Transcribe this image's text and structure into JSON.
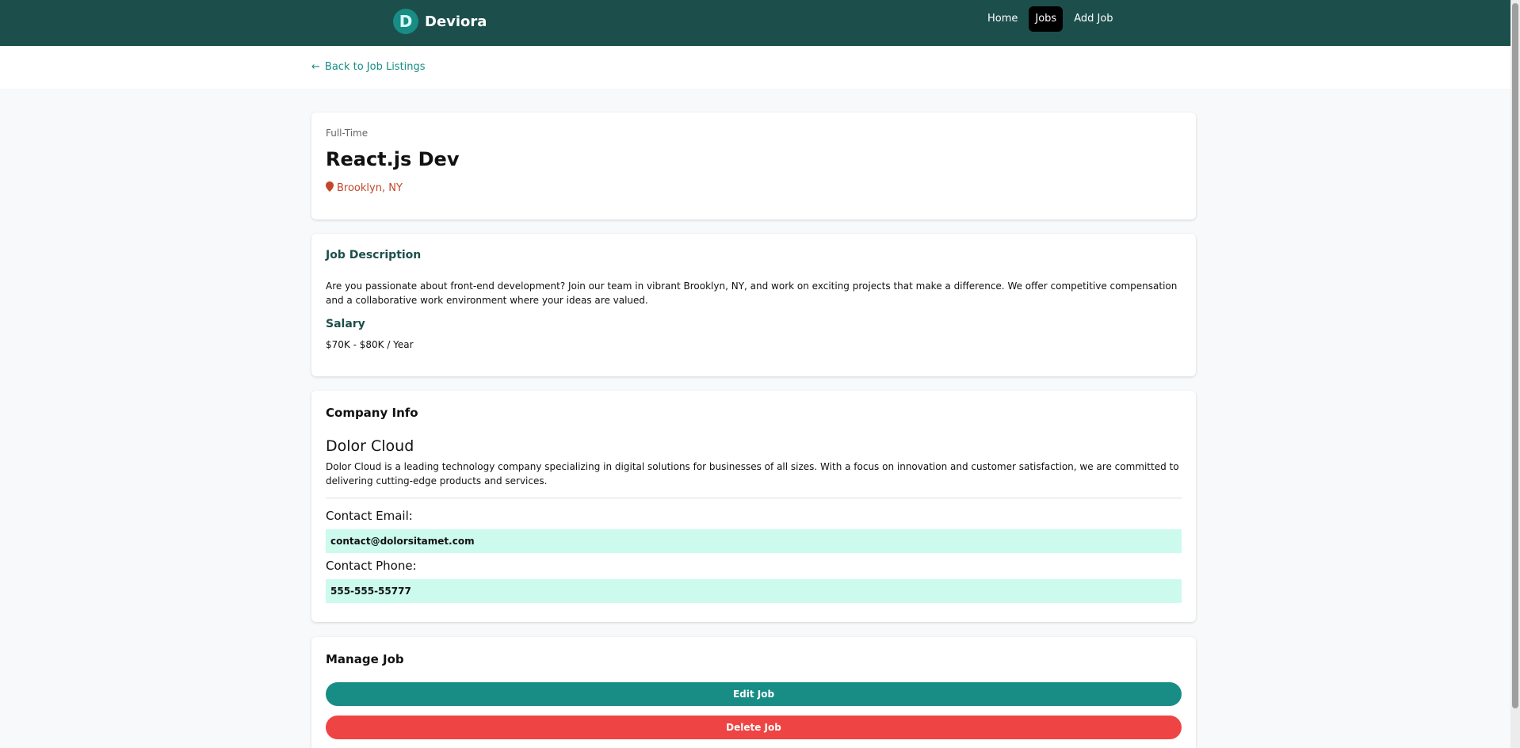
{
  "nav": {
    "logo_letter": "D",
    "brand_name": "Deviora",
    "links": [
      {
        "label": "Home"
      },
      {
        "label": "Jobs"
      },
      {
        "label": "Add Job"
      }
    ]
  },
  "back_link": {
    "label": "Back to Job Listings",
    "icon": "arrow-left-icon"
  },
  "job": {
    "type": "Full-Time",
    "title": "React.js Dev",
    "location": "Brooklyn, NY",
    "location_icon": "map-pin-icon",
    "description_heading": "Job Description",
    "description": "Are you passionate about front-end development? Join our team in vibrant Brooklyn, NY, and work on exciting projects that make a difference. We offer competitive compensation and a collaborative work environment where your ideas are valued.",
    "salary_heading": "Salary",
    "salary": "$70K - $80K / Year"
  },
  "company": {
    "heading": "Company Info",
    "name": "Dolor Cloud",
    "description": "Dolor Cloud is a leading technology company specializing in digital solutions for businesses of all sizes. With a focus on innovation and customer satisfaction, we are committed to delivering cutting-edge products and services.",
    "email_label": "Contact Email:",
    "email": "contact@dolorsitamet.com",
    "phone_label": "Contact Phone:",
    "phone": "555-555-55777"
  },
  "manage": {
    "heading": "Manage Job",
    "edit_label": "Edit Job",
    "delete_label": "Delete Job"
  },
  "colors": {
    "nav_bg": "#1c4f4b",
    "accent": "#178d86",
    "danger": "#ef4444",
    "location": "#c4472a",
    "contact_bg": "#ccfbee"
  }
}
